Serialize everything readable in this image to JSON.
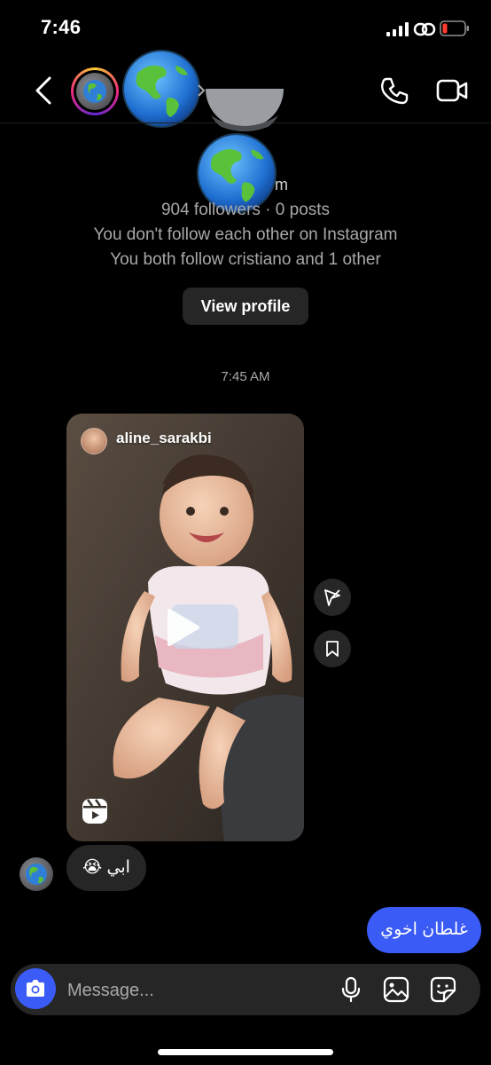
{
  "status_bar": {
    "time": "7:46"
  },
  "header": {
    "avatar_icon": "globe-emoji"
  },
  "intro": {
    "username_partial": "m",
    "followers": "904 followers · 0 posts",
    "relation": "You don't follow each other on Instagram",
    "mutual": "You both follow cristiano and 1 other",
    "view_profile_label": "View profile"
  },
  "conversation": {
    "timestamp": "7:45 AM",
    "shared_reel": {
      "username": "aline_sarakbi"
    },
    "received_message": "ابي 😭",
    "sent_message": "غلطان اخوي"
  },
  "composer": {
    "placeholder": "Message..."
  },
  "colors": {
    "background": "#000000",
    "bubble_received": "#262626",
    "bubble_sent": "#3a5bf5",
    "accent": "#3a5bf5"
  }
}
